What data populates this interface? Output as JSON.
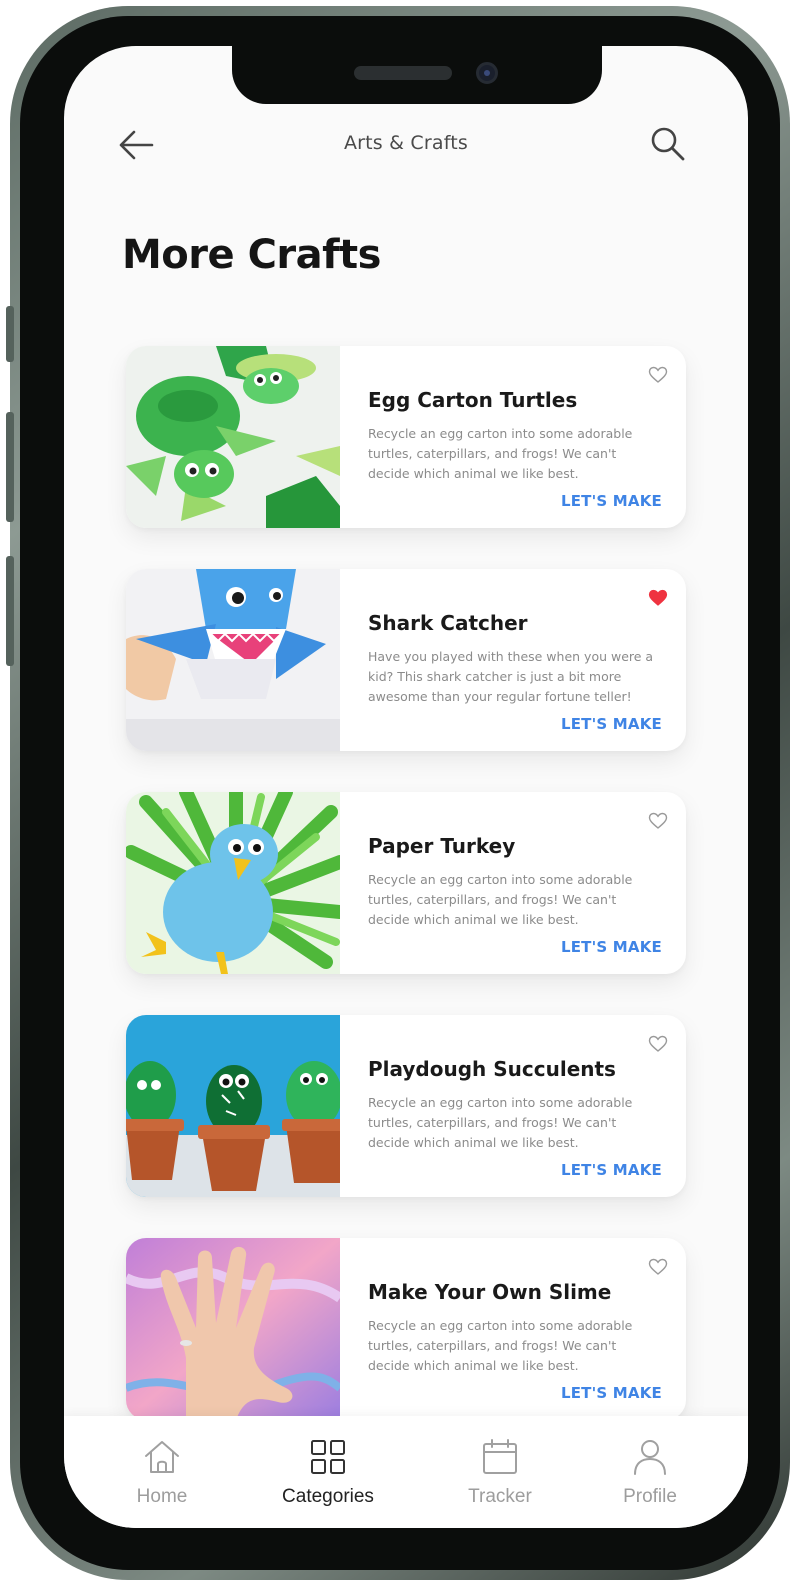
{
  "header": {
    "title": "Arts & Crafts"
  },
  "section": {
    "title": "More Crafts"
  },
  "cards": [
    {
      "title": "Egg Carton Turtles",
      "description": "Recycle an egg carton into some adorable turtles, caterpillars, and frogs! We can't decide which animal we like best.",
      "cta": "LET'S MAKE",
      "favorited": false
    },
    {
      "title": "Shark Catcher",
      "description": "Have you played with these when you were a kid? This shark catcher is just a bit more awesome than your regular fortune teller!",
      "cta": "LET'S MAKE",
      "favorited": true
    },
    {
      "title": "Paper Turkey",
      "description": "Recycle an egg carton into some adorable turtles, caterpillars, and frogs! We can't decide which animal we like best.",
      "cta": "LET'S MAKE",
      "favorited": false
    },
    {
      "title": "Playdough Succulents",
      "description": "Recycle an egg carton into some adorable turtles, caterpillars, and frogs! We can't decide which animal we like best.",
      "cta": "LET'S MAKE",
      "favorited": false
    },
    {
      "title": "Make Your Own Slime",
      "description": "Recycle an egg carton into some adorable turtles, caterpillars, and frogs! We can't decide which animal we like best.",
      "cta": "LET'S MAKE",
      "favorited": false
    }
  ],
  "bottom_nav": {
    "items": [
      {
        "label": "Home",
        "icon": "home-icon",
        "active": false
      },
      {
        "label": "Categories",
        "icon": "grid-icon",
        "active": true
      },
      {
        "label": "Tracker",
        "icon": "calendar-icon",
        "active": false
      },
      {
        "label": "Profile",
        "icon": "user-icon",
        "active": false
      }
    ]
  },
  "colors": {
    "accent": "#3f84e5",
    "favorite": "#ef3340",
    "background": "#fafafa"
  }
}
